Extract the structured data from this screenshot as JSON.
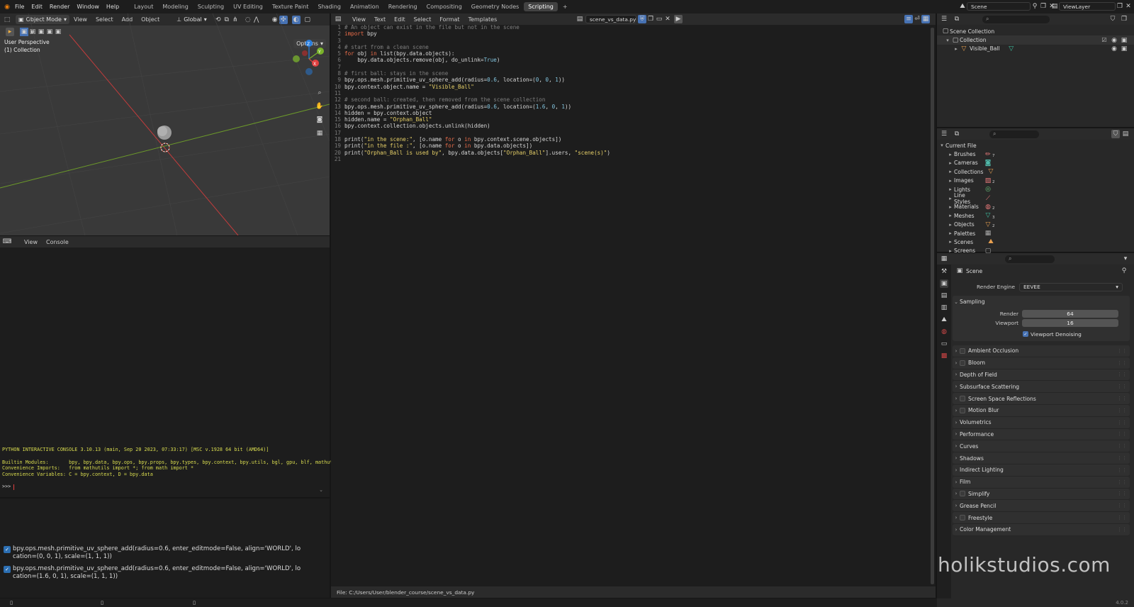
{
  "topbar": {
    "menus": [
      "File",
      "Edit",
      "Render",
      "Window",
      "Help"
    ],
    "workspaces": [
      "Layout",
      "Modeling",
      "Sculpting",
      "UV Editing",
      "Texture Paint",
      "Shading",
      "Animation",
      "Rendering",
      "Compositing",
      "Geometry Nodes",
      "Scripting"
    ],
    "active_workspace": "Scripting",
    "add_tab": "+",
    "scene_name": "Scene",
    "view_layer": "ViewLayer"
  },
  "viewport": {
    "mode": "Object Mode",
    "menus": [
      "View",
      "Select",
      "Add",
      "Object"
    ],
    "transform": "Global",
    "options_label": "Options",
    "perspective": "User Perspective",
    "collection": "(1) Collection",
    "gizmo_axes": [
      "Z",
      "Y",
      "X"
    ]
  },
  "console": {
    "menus": [
      "View",
      "Console"
    ],
    "banner": "PYTHON INTERACTIVE CONSOLE 3.10.13 (main, Sep 20 2023, 07:33:17) [MSC v.1928 64 bit (AMD64)]",
    "lines": [
      "Builtin Modules:       bpy, bpy.data, bpy.ops, bpy.props, bpy.types, bpy.context, bpy.utils, bgl, gpu, blf, mathutils",
      "Convenience Imports:   from mathutils import *; from math import *",
      "Convenience Variables: C = bpy.context, D = bpy.data"
    ],
    "prompt": ">>> "
  },
  "info_log": [
    {
      "line1": "bpy.ops.mesh.primitive_uv_sphere_add(radius=0.6, enter_editmode=False, align='WORLD', lo",
      "line2": "cation=(0, 0, 1), scale=(1, 1, 1))"
    },
    {
      "line1": "bpy.ops.mesh.primitive_uv_sphere_add(radius=0.6, enter_editmode=False, align='WORLD', lo",
      "line2": "cation=(1.6, 0, 1), scale=(1, 1, 1))"
    }
  ],
  "editor": {
    "menus": [
      "View",
      "Text",
      "Edit",
      "Select",
      "Format",
      "Templates"
    ],
    "filename": "scene_vs_data.py",
    "status_file": "File: C:/Users/User/blender_course/scene_vs_data.py",
    "code": [
      [
        [
          "cm",
          "# An object can exist in the file but not in the scene"
        ]
      ],
      [
        [
          "kw",
          "import"
        ],
        [
          "tx",
          " bpy"
        ]
      ],
      [],
      [
        [
          "cm",
          "# start from a clean scene"
        ]
      ],
      [
        [
          "kw",
          "for"
        ],
        [
          "tx",
          " obj "
        ],
        [
          "kw",
          "in"
        ],
        [
          "tx",
          " list(bpy.data.objects):"
        ]
      ],
      [
        [
          "tx",
          "    bpy.data.objects.remove(obj, do_unlink="
        ],
        [
          "nm",
          "True"
        ],
        [
          "tx",
          ")"
        ]
      ],
      [],
      [
        [
          "cm",
          "# first ball: stays in the scene"
        ]
      ],
      [
        [
          "tx",
          "bpy.ops.mesh.primitive_uv_sphere_add(radius="
        ],
        [
          "nm",
          "0.6"
        ],
        [
          "tx",
          ", location=("
        ],
        [
          "nm",
          "0"
        ],
        [
          "tx",
          ", "
        ],
        [
          "nm",
          "0"
        ],
        [
          "tx",
          ", "
        ],
        [
          "nm",
          "1"
        ],
        [
          "tx",
          "))"
        ]
      ],
      [
        [
          "tx",
          "bpy.context.object.name = "
        ],
        [
          "st",
          "\"Visible_Ball\""
        ]
      ],
      [],
      [
        [
          "cm",
          "# second ball: created, then removed from the scene collection"
        ]
      ],
      [
        [
          "tx",
          "bpy.ops.mesh.primitive_uv_sphere_add(radius="
        ],
        [
          "nm",
          "0.6"
        ],
        [
          "tx",
          ", location=("
        ],
        [
          "nm",
          "1.6"
        ],
        [
          "tx",
          ", "
        ],
        [
          "nm",
          "0"
        ],
        [
          "tx",
          ", "
        ],
        [
          "nm",
          "1"
        ],
        [
          "tx",
          "))"
        ]
      ],
      [
        [
          "tx",
          "hidden = bpy.context.object"
        ]
      ],
      [
        [
          "tx",
          "hidden.name = "
        ],
        [
          "st",
          "\"Orphan_Ball\""
        ]
      ],
      [
        [
          "tx",
          "bpy.context.collection.objects.unlink(hidden)"
        ]
      ],
      [],
      [
        [
          "tx",
          "print("
        ],
        [
          "st",
          "\"in the scene:\""
        ],
        [
          "tx",
          ", [o.name "
        ],
        [
          "kw",
          "for"
        ],
        [
          "tx",
          " o "
        ],
        [
          "kw",
          "in"
        ],
        [
          "tx",
          " bpy.context.scene.objects])"
        ]
      ],
      [
        [
          "tx",
          "print("
        ],
        [
          "st",
          "\"in the file :\""
        ],
        [
          "tx",
          ", [o.name "
        ],
        [
          "kw",
          "for"
        ],
        [
          "tx",
          " o "
        ],
        [
          "kw",
          "in"
        ],
        [
          "tx",
          " bpy.data.objects])"
        ]
      ],
      [
        [
          "tx",
          "print("
        ],
        [
          "st",
          "\"Orphan_Ball is used by\""
        ],
        [
          "tx",
          ", bpy.data.objects["
        ],
        [
          "st",
          "\"Orphan_Ball\""
        ],
        [
          "tx",
          "].users, "
        ],
        [
          "st",
          "\"scene(s)\""
        ],
        [
          "tx",
          ")"
        ]
      ],
      []
    ]
  },
  "outliner": {
    "root": "Scene Collection",
    "collection": "Collection",
    "object": "Visible_Ball"
  },
  "blendfile": {
    "root": "Current File",
    "items": [
      {
        "label": "Brushes",
        "badge": "7"
      },
      {
        "label": "Cameras",
        "badge": ""
      },
      {
        "label": "Collections",
        "badge": ""
      },
      {
        "label": "Images",
        "badge": "2"
      },
      {
        "label": "Lights",
        "badge": ""
      },
      {
        "label": "Line Styles",
        "badge": ""
      },
      {
        "label": "Materials",
        "badge": "2"
      },
      {
        "label": "Meshes",
        "badge": "3"
      },
      {
        "label": "Objects",
        "badge": "2"
      },
      {
        "label": "Palettes",
        "badge": ""
      },
      {
        "label": "Scenes",
        "badge": ""
      },
      {
        "label": "Screens",
        "badge": ""
      }
    ]
  },
  "properties": {
    "context": "Scene",
    "render_engine_label": "Render Engine",
    "render_engine": "EEVEE",
    "sampling": {
      "title": "Sampling",
      "render_label": "Render",
      "render_value": "64",
      "viewport_label": "Viewport",
      "viewport_value": "16",
      "denoise_label": "Viewport Denoising"
    },
    "panels": [
      {
        "label": "Ambient Occlusion",
        "check": true
      },
      {
        "label": "Bloom",
        "check": true
      },
      {
        "label": "Depth of Field",
        "check": false
      },
      {
        "label": "Subsurface Scattering",
        "check": false
      },
      {
        "label": "Screen Space Reflections",
        "check": true
      },
      {
        "label": "Motion Blur",
        "check": true
      },
      {
        "label": "Volumetrics",
        "check": false
      },
      {
        "label": "Performance",
        "check": false
      },
      {
        "label": "Curves",
        "check": false
      },
      {
        "label": "Shadows",
        "check": false
      },
      {
        "label": "Indirect Lighting",
        "check": false
      },
      {
        "label": "Film",
        "check": false
      },
      {
        "label": "Simplify",
        "check": true
      },
      {
        "label": "Grease Pencil",
        "check": false
      },
      {
        "label": "Freestyle",
        "check": true
      },
      {
        "label": "Color Management",
        "check": false
      }
    ]
  },
  "watermark": "holikstudios.com",
  "version": "4.0.2"
}
